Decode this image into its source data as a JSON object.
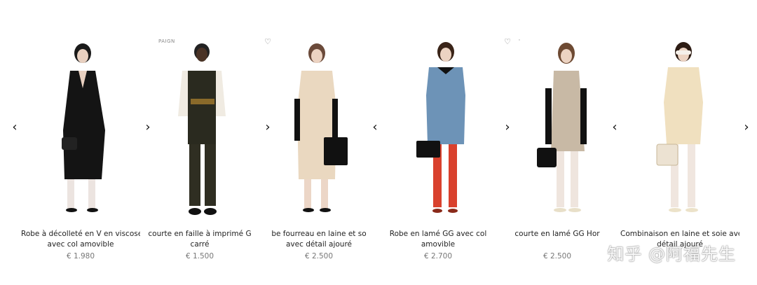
{
  "products": [
    {
      "title_line1": "Robe à décolleté en V en viscose",
      "title_line2": "avec col amovible",
      "price": "€ 1.980",
      "badge": ""
    },
    {
      "title_line1": "courte en faille à imprimé G",
      "title_line2": "carré",
      "price": "€ 1.500",
      "badge": "PAIGN"
    },
    {
      "title_line1": "be fourreau en laine et so",
      "title_line2": "avec détail ajouré",
      "price": "€ 2.500",
      "badge": ""
    },
    {
      "title_line1": "Robe en lamé GG avec col",
      "title_line2": "amovible",
      "price": "€ 2.700",
      "badge": ""
    },
    {
      "title_line1": "courte en lamé GG Hor",
      "title_line2": "",
      "price": "€ 2.500",
      "badge": "'"
    },
    {
      "title_line1": "Combinaison en laine et soie avec",
      "title_line2": "détail ajouré",
      "price": "",
      "badge": ""
    }
  ],
  "icons": {
    "wishlist": "heart-outline-icon",
    "prev": "chevron-left-icon",
    "next": "chevron-right-icon"
  },
  "watermark": "知乎 @阿福先生",
  "colors": {
    "text": "#222222",
    "price": "#777777",
    "background": "#ffffff"
  }
}
